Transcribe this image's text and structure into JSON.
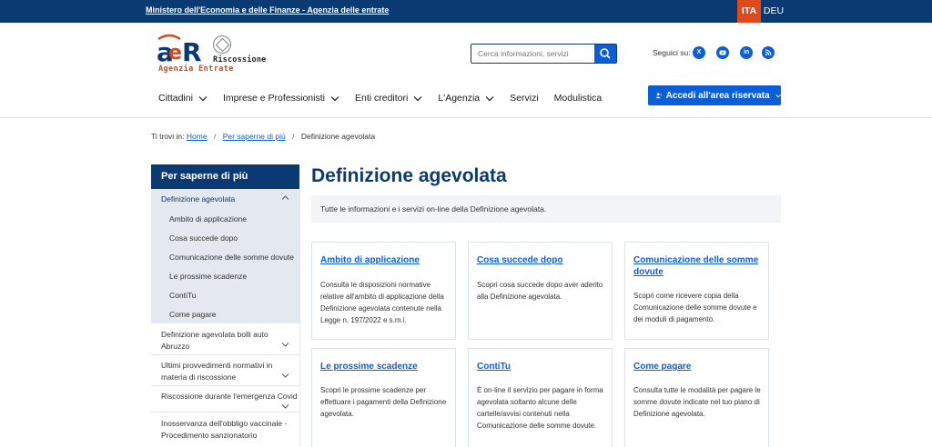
{
  "topbar": {
    "institution": "Ministero dell'Economia e delle Finanze - Agenzia delle entrate",
    "lang_active": "ITA",
    "lang_other": "DEU"
  },
  "logo": {
    "mark": "AeR",
    "line1": "Riscossione",
    "line2": "Agenzia Entrate"
  },
  "search": {
    "placeholder": "Cerca informazioni, servizi"
  },
  "follow": {
    "label": "Seguici su:",
    "icons": [
      "x-icon",
      "youtube-icon",
      "linkedin-icon",
      "rss-icon"
    ]
  },
  "nav": {
    "items": [
      {
        "label": "Cittadini",
        "dropdown": true
      },
      {
        "label": "Imprese e Professionisti",
        "dropdown": true
      },
      {
        "label": "Enti creditori",
        "dropdown": true
      },
      {
        "label": "L'Agenzia",
        "dropdown": true
      },
      {
        "label": "Servizi",
        "dropdown": false
      },
      {
        "label": "Modulistica",
        "dropdown": false
      }
    ],
    "login": "Accedi all'area riservata"
  },
  "breadcrumb": {
    "prefix": "Ti trovi in:",
    "home": "Home",
    "parent": "Per saperne di più",
    "current": "Definizione agevolata"
  },
  "sidebar": {
    "heading": "Per saperne di più",
    "current": "Definizione agevolata",
    "subitems": [
      "Ambito di applicazione",
      "Cosa succede dopo",
      "Comunicazione delle somme dovute",
      "Le prossime scadenze",
      "ContiTu",
      "Come pagare"
    ],
    "items": [
      {
        "line1": "Definizione agevolata bolli auto",
        "line2": "Abruzzo"
      },
      {
        "line1": "Ultimi provvedimenti normativi in",
        "line2": "materia di riscossione"
      },
      {
        "line1": "Riscossione durante l'emergenza Covid",
        "line2": ""
      },
      {
        "line1": "Inosservanza dell'obbligo vaccinale -",
        "line2": "Procedimento sanzionatorio"
      }
    ]
  },
  "main": {
    "title": "Definizione agevolata",
    "intro": "Tutte le informazioni e i servizi on-line della Definizione agevolata.",
    "cards": [
      {
        "title": "Ambito di applicazione",
        "desc": "Consulta le disposizioni normative relative all'ambito di applicazione della Definizione agevolata contenute nella Legge n. 197/2022 e s.m.i."
      },
      {
        "title": "Cosa succede dopo",
        "desc": "Scopri cosa succede dopo aver aderito alla Definizione agevolata."
      },
      {
        "title": "Comunicazione delle somme dovute",
        "desc": "Scopri come ricevere copia della Comunicazione delle somme dovute e dei moduli di pagamento."
      },
      {
        "title": "Le prossime scadenze",
        "desc": "Scopri le prossime scadenze per effettuare i pagamenti della Definizione agevolata."
      },
      {
        "title": "ContiTu",
        "desc": "È on-line il servizio per pagare in forma agevolata soltanto alcune delle cartelle/avvisi contenuti nella Comunicazione delle somme dovute."
      },
      {
        "title": "Come pagare",
        "desc": "Consulta tutte le modalità per pagare le somme dovute indicate nel tuo piano di Definizione agevolata."
      }
    ]
  },
  "colors": {
    "primary_dark": "#0b3a73",
    "primary": "#0b5ed7",
    "accent": "#e0491b"
  }
}
